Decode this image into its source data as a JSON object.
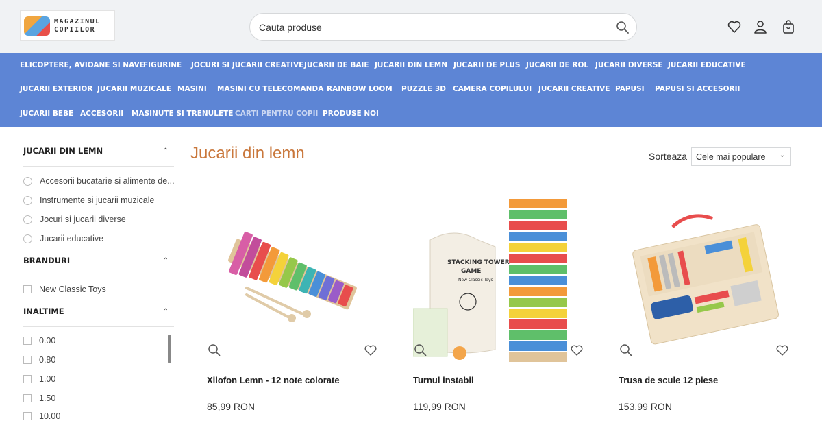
{
  "brand": {
    "line1": "MAGAZINUL",
    "line2": "COPIILOR"
  },
  "search": {
    "placeholder": "Cauta produse"
  },
  "nav": {
    "row1": [
      "ELICOPTERE, AVIOANE SI NAVE",
      "FIGURINE",
      "JOCURI SI JUCARII CREATIVE",
      "JUCARII DE BAIE",
      "JUCARII DIN LEMN",
      "JUCARII DE PLUS",
      "JUCARII DE ROL",
      "JUCARII DIVERSE",
      "JUCARII EDUCATIVE"
    ],
    "row2": [
      "JUCARII EXTERIOR",
      "JUCARII MUZICALE",
      "MASINI",
      "MASINI CU TELECOMANDA",
      "RAINBOW LOOM",
      "PUZZLE 3D",
      "CAMERA COPILULUI",
      "JUCARII CREATIVE",
      "PAPUSI",
      "PAPUSI SI ACCESORII"
    ],
    "row3": [
      "JUCARII BEBE",
      "ACCESORII",
      "MASINUTE SI TRENULETE",
      "CARTI PENTRU COPII",
      "PRODUSE NOI"
    ]
  },
  "sidebar": {
    "category": {
      "heading": "JUCARII DIN LEMN",
      "items": [
        "Accesorii bucatarie si alimente de...",
        "Instrumente si jucarii muzicale",
        "Jocuri si jucarii diverse",
        "Jucarii educative"
      ]
    },
    "brands": {
      "heading": "BRANDURI",
      "items": [
        "New Classic Toys"
      ]
    },
    "height": {
      "heading": "INALTIME",
      "items": [
        "0.00",
        "0.80",
        "1.00",
        "1.50",
        "10.00"
      ]
    }
  },
  "main": {
    "title": "Jucarii din lemn",
    "sort": {
      "label": "Sorteaza",
      "value": "Cele mai populare"
    }
  },
  "products": [
    {
      "name": "Xilofon Lemn - 12 note colorate",
      "price": "85,99 RON"
    },
    {
      "name": "Turnul instabil",
      "price": "119,99 RON"
    },
    {
      "name": "Trusa de scule 12 piese",
      "price": "153,99 RON"
    }
  ],
  "product_art": {
    "tower_bag_line1": "STACKING TOWER",
    "tower_bag_line2": "GAME",
    "tower_bag_line3": "New Classic Toys"
  },
  "colors": {
    "accent": "#c9773b",
    "nav_bg": "#5d85d5",
    "header_bg": "#f0f2f4"
  },
  "icons": {
    "search": "search-icon",
    "wishlist": "heart-icon",
    "account": "user-icon",
    "cart": "bag-icon",
    "zoom": "zoom-icon"
  }
}
